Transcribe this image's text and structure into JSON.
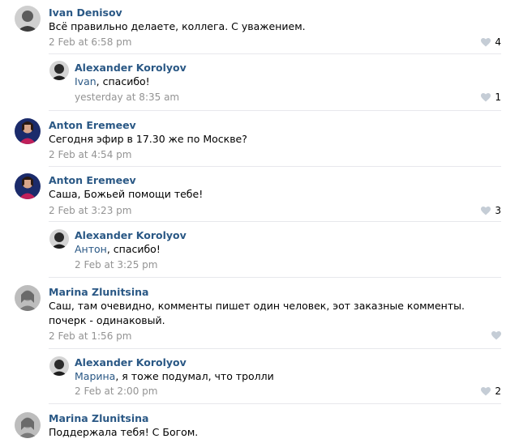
{
  "comments": [
    {
      "name": "Ivan Denisov",
      "text": "Всё правильно делаете, коллега. С уважением.",
      "date": "2 Feb at 6:58 pm",
      "likes": "4"
    },
    {
      "name": "Alexander Korolyov",
      "mention": "Ivan",
      "text_rest": ", спасибо!",
      "date": "yesterday at 8:35 am",
      "likes": "1"
    },
    {
      "name": "Anton Eremeev",
      "text": "Сегодня эфир в 17.30 же по Москве?",
      "date": "2 Feb at 4:54 pm"
    },
    {
      "name": "Anton Eremeev",
      "text": "Саша, Божьей помощи тебе!",
      "date": "2 Feb at 3:23 pm",
      "likes": "3"
    },
    {
      "name": "Alexander Korolyov",
      "mention": "Антон",
      "text_rest": ", спасибо!",
      "date": "2 Feb at 3:25 pm"
    },
    {
      "name": "Marina Zlunitsina",
      "text": "Саш, там очевидно, комменты пишет один человек, эот заказные комменты. почерк - одинаковый.",
      "date": "2 Feb at 1:56 pm"
    },
    {
      "name": "Alexander Korolyov",
      "mention": "Марина",
      "text_rest": ", я тоже подумал, что тролли",
      "date": "2 Feb at 2:00 pm",
      "likes": "2"
    },
    {
      "name": "Marina Zlunitsina",
      "text": "Поддержала тебя! С Богом."
    }
  ],
  "colors": {
    "link": "#2a5885",
    "meta": "#939393",
    "like_icon": "#c5cdd6",
    "separator": "#e7e8ec"
  },
  "icons": {
    "like": "heart-icon"
  }
}
